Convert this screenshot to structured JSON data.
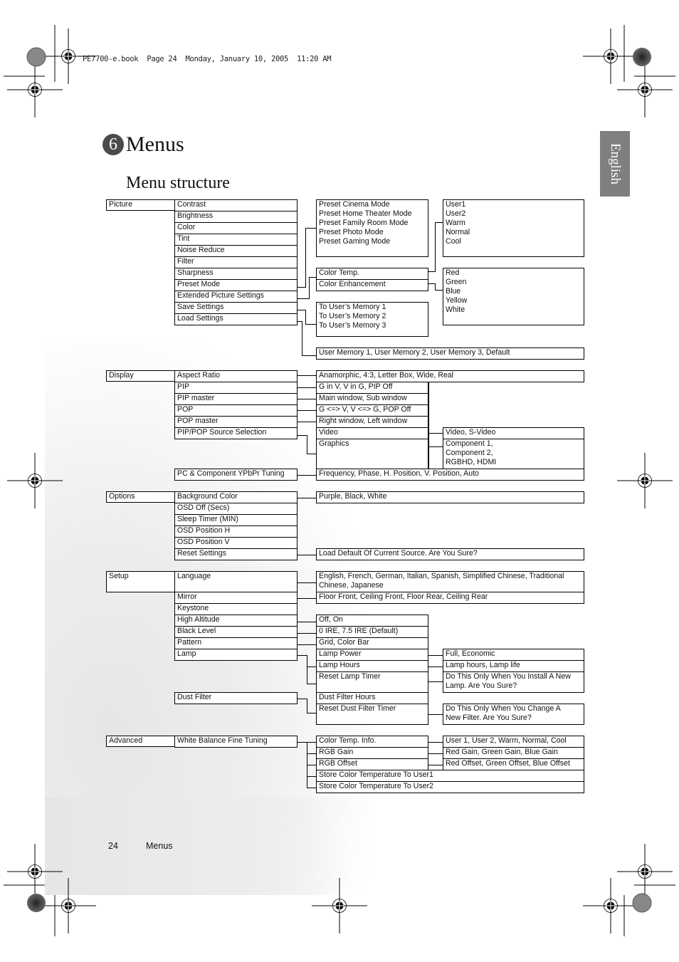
{
  "print_header": "PE7700-e.book  Page 24  Monday, January 10, 2005  11:20 AM",
  "chapter": {
    "number": "6",
    "title": "Menus"
  },
  "section_title": "Menu structure",
  "language_tab": "English",
  "footer": {
    "page_number": "24",
    "label": "Menus"
  },
  "menu": {
    "picture": {
      "label": "Picture",
      "items": [
        "Contrast",
        "Brightness",
        "Color",
        "Tint",
        "Noise Reduce",
        "Filter",
        "Sharpness",
        "Preset Mode",
        "Extended Picture Settings",
        "Save Settings",
        "Load Settings"
      ],
      "preset_modes": [
        "Preset Cinema Mode",
        "Preset Home Theater Mode",
        "Preset Family Room Mode",
        "Preset Photo Mode",
        "Preset Gaming Mode"
      ],
      "extended": [
        "Color Temp.",
        "Color Enhancement"
      ],
      "color_temp_options": [
        "User1",
        "User2",
        "Warm",
        "Normal",
        "Cool"
      ],
      "color_enhancement_options": [
        "Red",
        "Green",
        "Blue",
        "Yellow",
        "White"
      ],
      "save_options": [
        "To User’s Memory 1",
        "To User’s Memory 2",
        "To User’s Memory 3"
      ],
      "load_options": "User Memory 1, User Memory 2, User Memory 3, Default"
    },
    "display": {
      "label": "Display",
      "items": [
        "Aspect Ratio",
        "PIP",
        "PIP master",
        "POP",
        "POP master",
        "PIP/POP Source Selection"
      ],
      "tuning": "PC & Component YPbPr Tuning",
      "values": [
        "Anamorphic, 4:3, Letter Box, Wide, Real",
        "G in V, V in G, PIP Off",
        "Main window, Sub window",
        "G <=> V, V <=> G, POP Off",
        "Right window, Left window"
      ],
      "sources": [
        "Video",
        "Graphics"
      ],
      "video_options": "Video, S-Video",
      "graphics_options": "Component 1,\nComponent 2,\nRGBHD, HDMI",
      "tuning_options": "Frequency, Phase, H. Position, V. Position, Auto"
    },
    "options": {
      "label": "Options",
      "items": [
        "Background Color",
        "OSD Off (Secs)",
        "Sleep Timer (MIN)",
        "OSD Position H",
        "OSD Position V",
        "Reset Settings"
      ],
      "background_options": "Purple, Black, White",
      "reset_options": "Load Default Of Current Source. Are You Sure?"
    },
    "setup": {
      "label": "Setup",
      "items": [
        "Language",
        "Mirror",
        "Keystone",
        "High Altitude",
        "Black Level",
        "Pattern",
        "Lamp"
      ],
      "dust_filter": "Dust Filter",
      "language_options": "English, French, German, Italian, Spanish, Simplified Chinese, Traditional\nChinese, Japanese",
      "mirror_options": "Floor Front, Ceiling Front, Floor Rear, Ceiling Rear",
      "altitude_options": "Off, On",
      "black_level_options": "0 IRE, 7.5 IRE (Default)",
      "pattern_options": "Grid, Color Bar",
      "lamp_items": [
        "Lamp Power",
        "Lamp Hours",
        "Reset Lamp Timer"
      ],
      "lamp_power_options": "Full, Economic",
      "lamp_hours_options": "Lamp hours, Lamp life",
      "reset_lamp_options": "Do This Only When You Install A New\nLamp. Are You Sure?",
      "dust_items": [
        "Dust Filter Hours",
        "Reset Dust Filter Timer"
      ],
      "reset_dust_options": "Do This Only When You Change A\nNew Filter. Are You Sure?"
    },
    "advanced": {
      "label": "Advanced",
      "items": [
        "White Balance Fine Tuning"
      ],
      "wb_items": [
        "Color Temp. Info.",
        "RGB Gain",
        "RGB Offset",
        "Store Color Temperature To User1",
        "Store Color Temperature To User2"
      ],
      "wb_values": [
        "User 1, User 2, Warm, Normal, Cool",
        "Red Gain, Green Gain, Blue Gain",
        "Red Offset, Green Offset, Blue Offset"
      ]
    }
  }
}
